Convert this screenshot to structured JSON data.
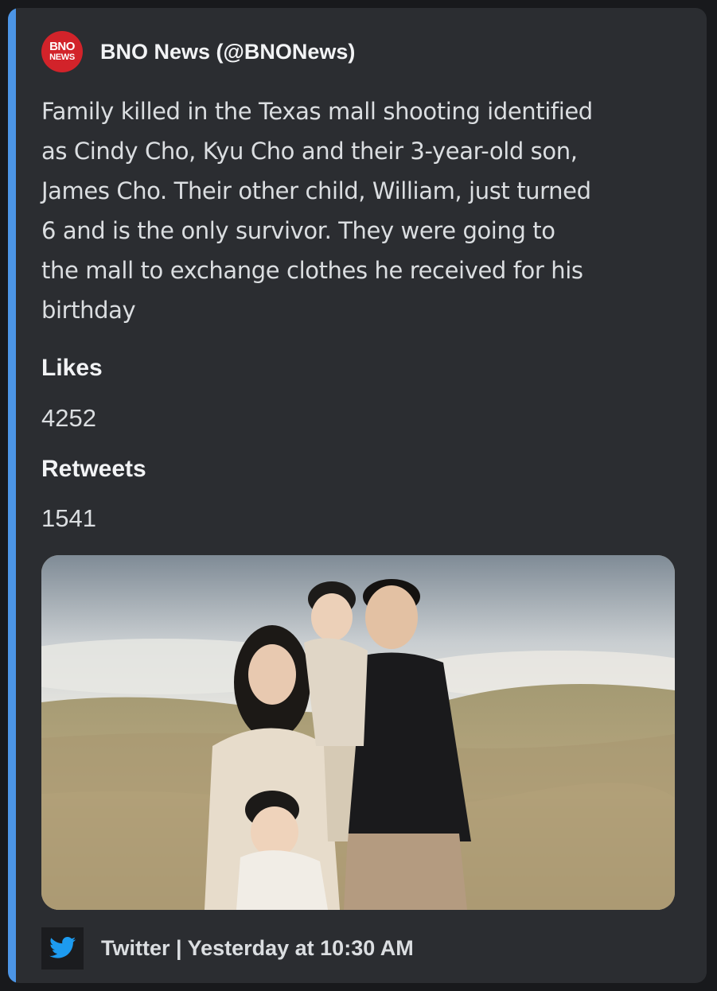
{
  "embed": {
    "accent_color": "#4c95e6",
    "author": {
      "avatar_text_top": "BNO",
      "avatar_text_bottom": "NEWS",
      "avatar_color": "#d2232a",
      "name": "BNO News (@BNONews)"
    },
    "description_lines": [
      "Family killed in the Texas mall shooting identified",
      "as Cindy Cho, Kyu Cho and their 3-year-old son,",
      "James Cho. Their other child, William, just turned",
      "6 and is the only survivor. They were going to",
      "the mall to exchange clothes he received for his",
      "birthday"
    ],
    "fields": {
      "likes_label": "Likes",
      "likes_value": "4252",
      "retweets_label": "Retweets",
      "retweets_value": "1541"
    },
    "image": {
      "icon": "photo-image"
    },
    "footer": {
      "icon": "twitter-bird-icon",
      "icon_color": "#1d9bf0",
      "text": "Twitter | Yesterday at 10:30 AM"
    }
  }
}
